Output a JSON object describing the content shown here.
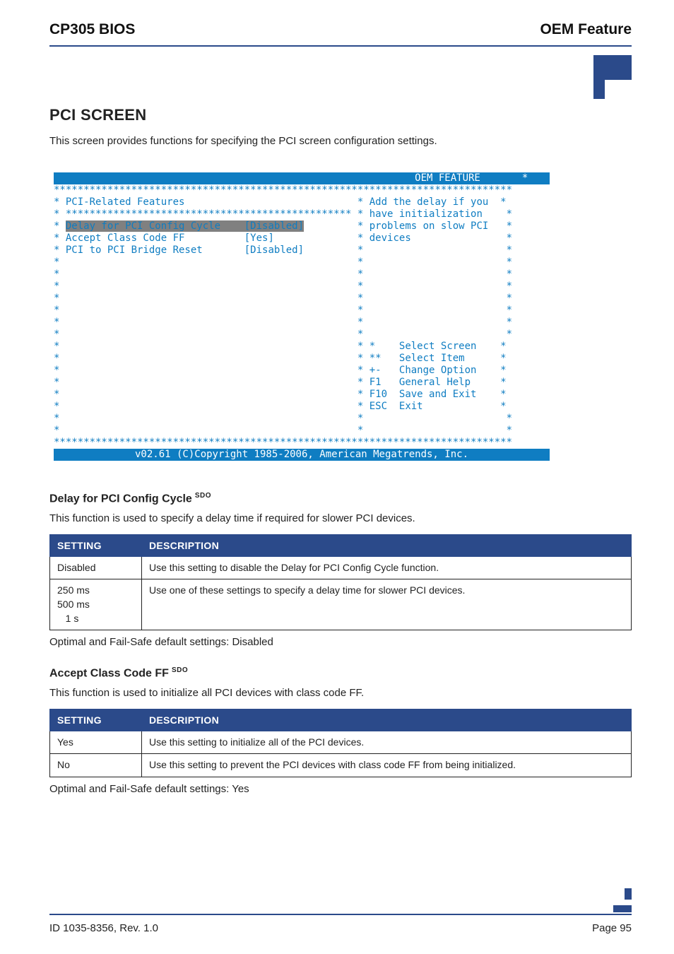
{
  "header": {
    "left": "CP305 BIOS",
    "right": "OEM Feature"
  },
  "section_title": "PCI SCREEN",
  "section_intro": "This screen provides functions for specifying the PCI screen configuration settings.",
  "bios": {
    "title": "OEM FEATURE",
    "left": {
      "heading": "PCI-Related Features",
      "items": [
        {
          "label": "Delay for PCI Config Cycle",
          "value": "[Disabled]",
          "selected": true
        },
        {
          "label": "Accept Class Code FF",
          "value": "[Yes]",
          "selected": false
        },
        {
          "label": "PCI to PCI Bridge Reset",
          "value": "[Disabled]",
          "selected": false
        }
      ]
    },
    "help_lines": [
      "Add the delay if you",
      "have initialization",
      "problems on slow PCI",
      "devices"
    ],
    "keys": [
      {
        "k": "*",
        "t": "Select Screen"
      },
      {
        "k": "**",
        "t": "Select Item"
      },
      {
        "k": "+-",
        "t": "Change Option"
      },
      {
        "k": "F1",
        "t": "General Help"
      },
      {
        "k": "F10",
        "t": "Save and Exit"
      },
      {
        "k": "ESC",
        "t": "Exit"
      }
    ],
    "footer": "v02.61 (C)Copyright 1985-2006, American Megatrends, Inc."
  },
  "delay_section": {
    "title": "Delay for PCI Config Cycle",
    "sup": "SDO",
    "intro": "This function is used to specify a delay time if required for slower PCI devices.",
    "headers": {
      "setting": "SETTING",
      "description": "DESCRIPTION"
    },
    "rows": [
      {
        "setting": "Disabled",
        "description": "Use this setting to disable the Delay for PCI Config Cycle function."
      },
      {
        "setting": "250 ms\n500 ms\n   1 s",
        "description": "Use one of these settings to specify a delay time for slower PCI devices."
      }
    ],
    "defaults": "Optimal and Fail-Safe default settings: Disabled"
  },
  "accept_section": {
    "title": "Accept Class Code FF",
    "sup": "SDO",
    "intro": "This function is used to initialize all PCI devices with class code FF.",
    "headers": {
      "setting": "SETTING",
      "description": "DESCRIPTION"
    },
    "rows": [
      {
        "setting": "Yes",
        "description": "Use this setting to initialize all of the PCI devices."
      },
      {
        "setting": "No",
        "description": "Use this setting to prevent the PCI devices with class code FF from being initialized."
      }
    ],
    "defaults": "Optimal and Fail-Safe default settings: Yes"
  },
  "footer": {
    "left": "ID 1035-8356, Rev. 1.0",
    "right": "Page 95"
  }
}
